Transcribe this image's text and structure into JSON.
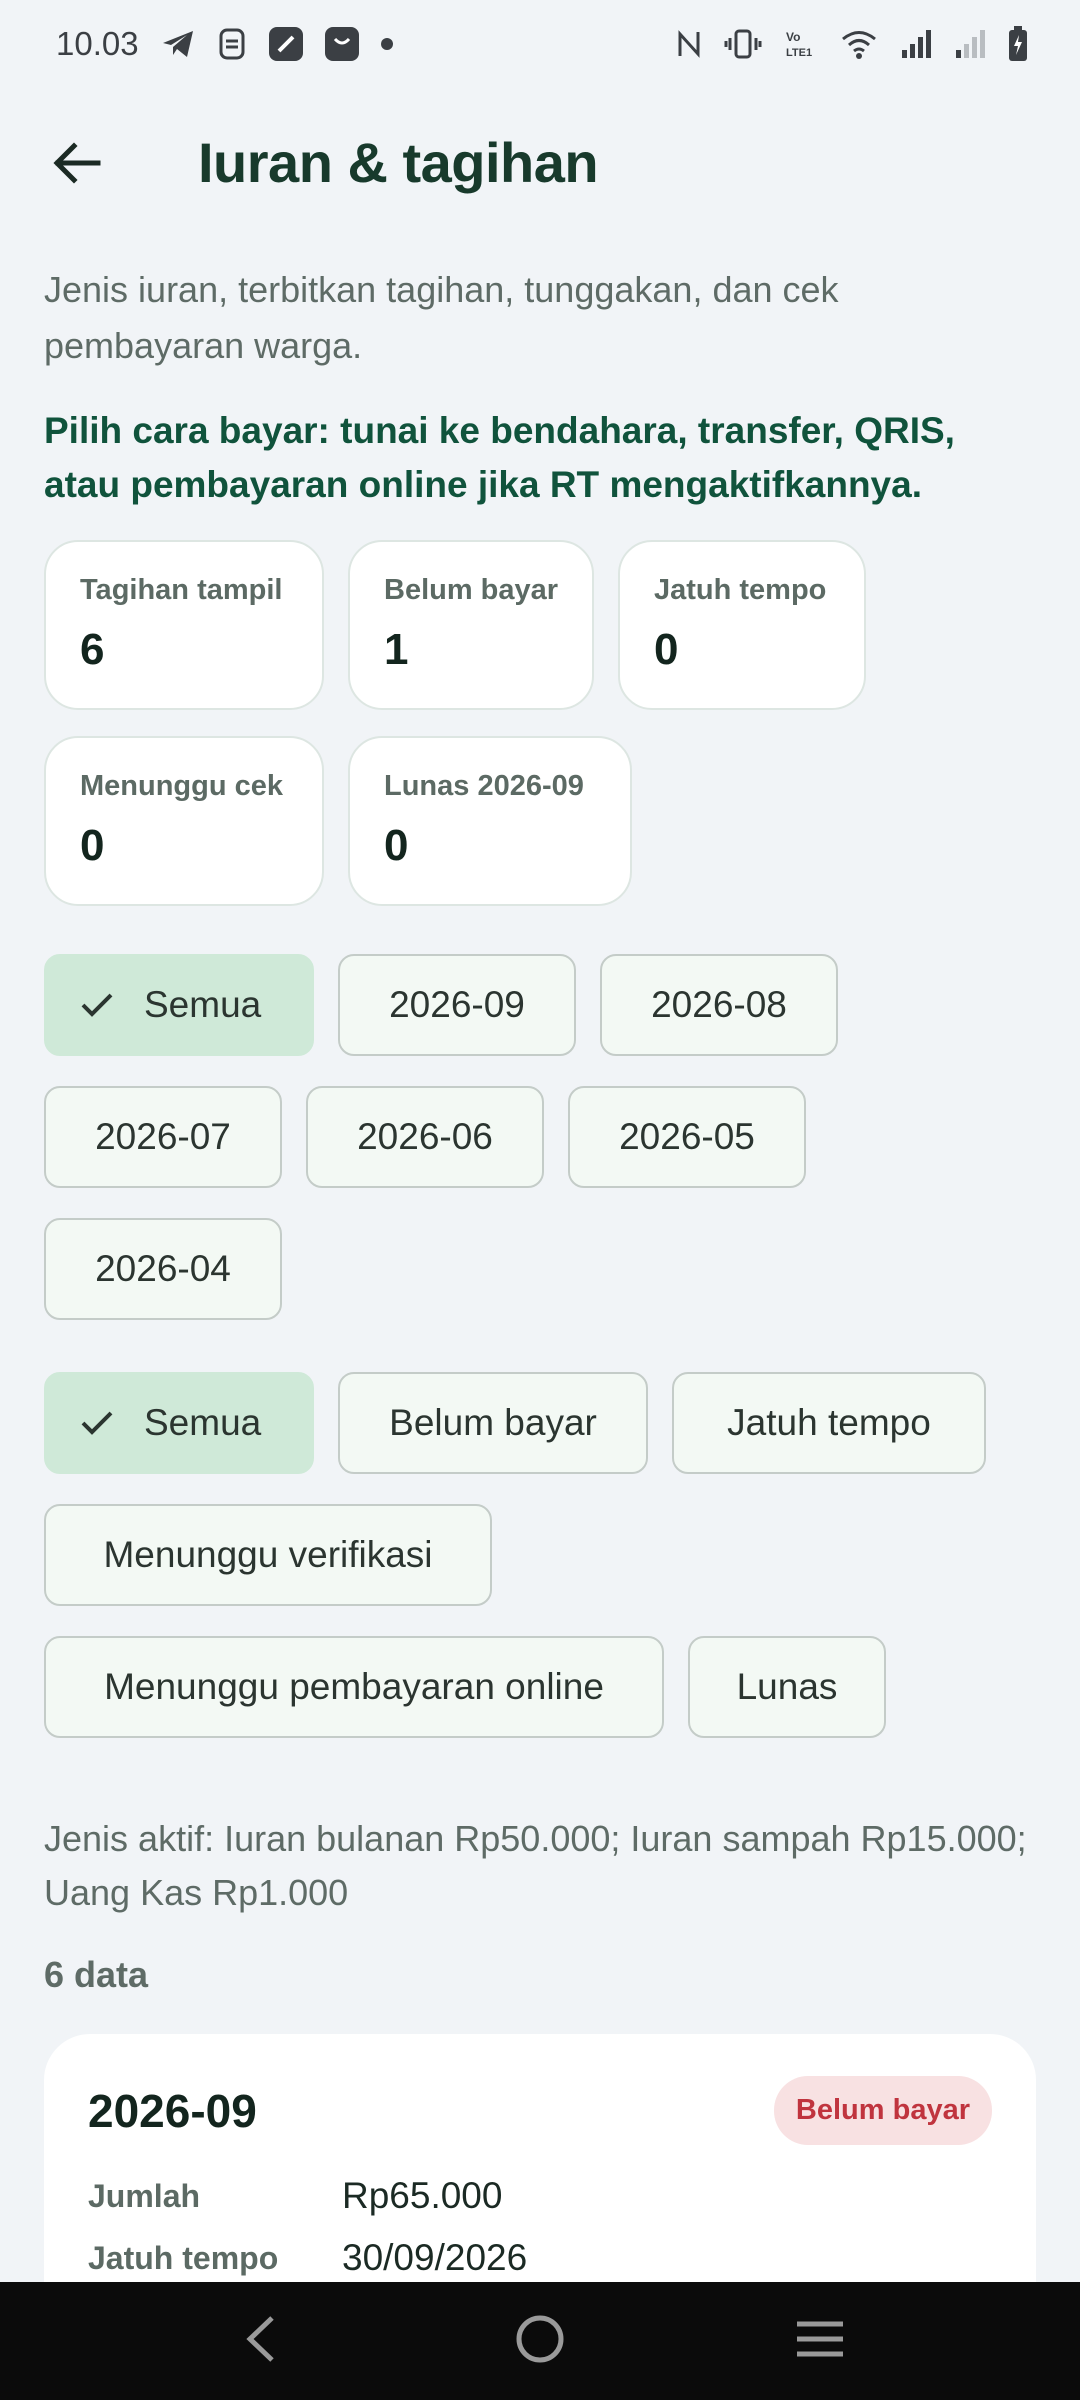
{
  "status_bar": {
    "time": "10.03",
    "left_icons": [
      "telegram-icon",
      "app-icon",
      "app-icon",
      "shop-icon",
      "dot-icon"
    ],
    "right_icons": [
      "nfc-icon",
      "vibrate-icon",
      "volte-icon",
      "wifi-icon",
      "signal-icon",
      "signal-weak-icon",
      "battery-icon"
    ],
    "volte_text": "Vo\nLTE1"
  },
  "header": {
    "title": "Iuran & tagihan",
    "back_icon": "arrow-left-icon"
  },
  "description": "Jenis iuran, terbitkan tagihan, tunggakan, dan cek pembayaran warga.",
  "payment_hint": "Pilih cara bayar: tunai ke bendahara, transfer, QRIS, atau pembayaran online jika RT mengaktifkannya.",
  "stats": [
    {
      "label": "Tagihan tampil",
      "value": "6"
    },
    {
      "label": "Belum bayar",
      "value": "1"
    },
    {
      "label": "Jatuh tempo",
      "value": "0"
    },
    {
      "label": "Menunggu cek",
      "value": "0"
    },
    {
      "label": "Lunas 2026-09",
      "value": "0"
    }
  ],
  "period_filters": {
    "selected": "Semua",
    "options": [
      "Semua",
      "2026-09",
      "2026-08",
      "2026-07",
      "2026-06",
      "2026-05",
      "2026-04"
    ]
  },
  "status_filters": {
    "selected": "Semua",
    "options": [
      "Semua",
      "Belum bayar",
      "Jatuh tempo",
      "Menunggu verifikasi",
      "Menunggu pembayaran online",
      "Lunas"
    ]
  },
  "active_types": "Jenis aktif: Iuran bulanan Rp50.000; Iuran sampah Rp15.000; Uang Kas Rp1.000",
  "data_count": "6 data",
  "bills": [
    {
      "period": "2026-09",
      "status": "Belum bayar",
      "status_color": "#c0343e",
      "amount_label": "Jumlah",
      "amount": "Rp65.000",
      "due_label": "Jatuh tempo",
      "due": "30/09/2026"
    }
  ],
  "nav": {
    "back_icon": "nav-back-icon",
    "home_icon": "nav-home-icon",
    "recents_icon": "nav-menu-icon"
  },
  "colors": {
    "background": "#f1f4f7",
    "primary_dark": "#10533c",
    "chip_selected": "#cfe9d8",
    "badge_bg": "#f8e1e2"
  }
}
